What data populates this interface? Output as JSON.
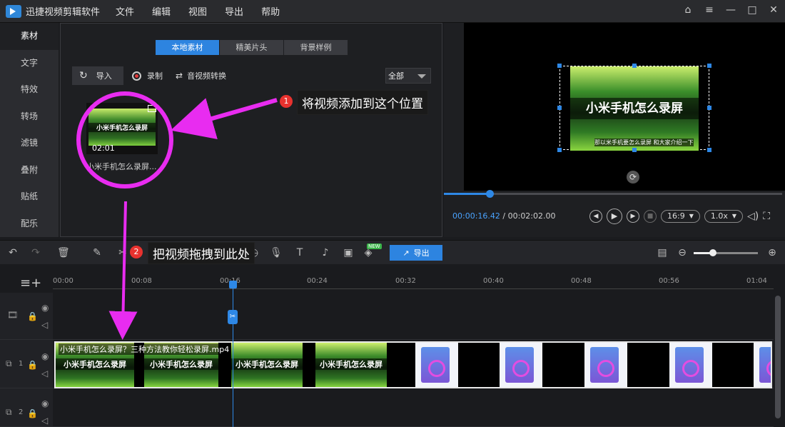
{
  "app": {
    "title": "迅捷视频剪辑软件"
  },
  "menu": [
    "文件",
    "编辑",
    "视图",
    "导出",
    "帮助"
  ],
  "window_controls": [
    "home-icon",
    "menu-icon",
    "minimize-icon",
    "maximize-icon",
    "close-icon"
  ],
  "sidebar": {
    "items": [
      {
        "label": "素材",
        "active": true
      },
      {
        "label": "文字"
      },
      {
        "label": "特效"
      },
      {
        "label": "转场"
      },
      {
        "label": "滤镜"
      },
      {
        "label": "叠附"
      },
      {
        "label": "贴纸"
      },
      {
        "label": "配乐"
      }
    ]
  },
  "media": {
    "tabs": [
      {
        "label": "本地素材",
        "active": true
      },
      {
        "label": "精美片头"
      },
      {
        "label": "背景样例"
      }
    ],
    "import_label": "导入",
    "record_label": "录制",
    "convert_label": "音视频转换",
    "filter_value": "全部",
    "clip": {
      "title_overlay": "小米手机怎么录屏",
      "duration": "02:01",
      "name": "小米手机怎么录屏..."
    }
  },
  "annotations": {
    "step1": {
      "number": "1",
      "text": "将视频添加到这个位置"
    },
    "step2": {
      "number": "2",
      "text": "把视频拖拽到此处"
    }
  },
  "preview": {
    "title_overlay": "小米手机怎么录屏",
    "subtitle_overlay": "那以米手机要怎么录屏 和大家介绍一下",
    "current_time": "00:00:16.42",
    "separator": " / ",
    "total_time": "00:02:02.00",
    "progress": 0.135,
    "ratio": "16:9",
    "speed": "1.0x"
  },
  "timeline": {
    "export_label": "导出",
    "new_badge": "NEW",
    "zoom": 0.3,
    "ruler": [
      "00:00",
      "00:08",
      "00:16",
      "00:24",
      "00:32",
      "00:40",
      "00:48",
      "00:56",
      "01:04"
    ],
    "clip_label": "小米手机怎么录屏？三种方法教你轻松录屏.mp4",
    "frame_text": "小米手机怎么录屏",
    "tracks": [
      {
        "label": ""
      },
      {
        "label": "1"
      },
      {
        "label": "2"
      }
    ]
  },
  "colors": {
    "accent": "#2d84e0",
    "annotation": "#e82cf0",
    "badge": "#e8322f"
  }
}
